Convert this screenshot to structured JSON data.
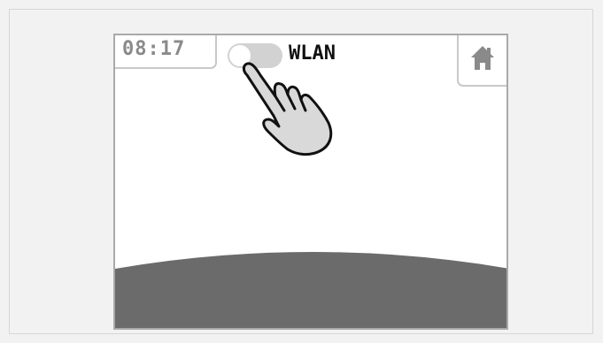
{
  "statusbar": {
    "time": "08:17"
  },
  "wlan": {
    "label": "WLAN",
    "enabled": false
  },
  "home": {
    "icon": "home-icon"
  },
  "gesture": {
    "icon": "pointing-hand-icon"
  },
  "colors": {
    "background": "#f2f2f2",
    "screen": "#ffffff",
    "ground": "#6b6b6b",
    "toggle_off": "#d2d2d2",
    "clock_text": "#8a8a8a",
    "home_icon": "#8a8a8a"
  }
}
